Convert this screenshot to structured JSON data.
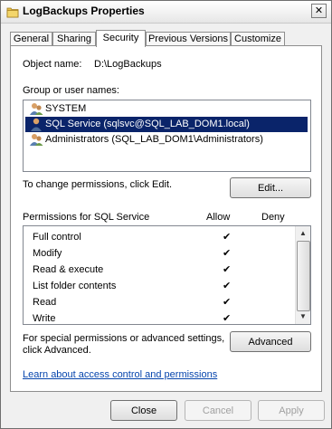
{
  "window": {
    "title": "LogBackups Properties",
    "close_glyph": "✕"
  },
  "tabs": [
    {
      "label": "General"
    },
    {
      "label": "Sharing"
    },
    {
      "label": "Security",
      "active": true
    },
    {
      "label": "Previous Versions"
    },
    {
      "label": "Customize"
    }
  ],
  "security": {
    "object_name_label": "Object name:",
    "object_name_value": "D:\\LogBackups",
    "group_label": "Group or user names:",
    "users": [
      {
        "label": "SYSTEM",
        "icon": "users-group-icon"
      },
      {
        "label": "SQL Service (sqlsvc@SQL_LAB_DOM1.local)",
        "icon": "user-icon",
        "selected": true
      },
      {
        "label": "Administrators (SQL_LAB_DOM1\\Administrators)",
        "icon": "users-group-icon"
      }
    ],
    "change_text": "To change permissions, click Edit.",
    "edit_button": "Edit...",
    "permissions_label": "Permissions for SQL Service",
    "allow_header": "Allow",
    "deny_header": "Deny",
    "permissions": [
      {
        "name": "Full control",
        "allow": true,
        "deny": false
      },
      {
        "name": "Modify",
        "allow": true,
        "deny": false
      },
      {
        "name": "Read & execute",
        "allow": true,
        "deny": false
      },
      {
        "name": "List folder contents",
        "allow": true,
        "deny": false
      },
      {
        "name": "Read",
        "allow": true,
        "deny": false
      },
      {
        "name": "Write",
        "allow": true,
        "deny": false
      }
    ],
    "special_text_line1": "For special permissions or advanced settings,",
    "special_text_line2": "click Advanced.",
    "advanced_button": "Advanced",
    "learn_link": "Learn about access control and permissions"
  },
  "footer": {
    "close_button": "Close",
    "cancel_button": "Cancel",
    "apply_button": "Apply"
  },
  "colors": {
    "selection": "#0a246a",
    "link": "#0645ad"
  }
}
